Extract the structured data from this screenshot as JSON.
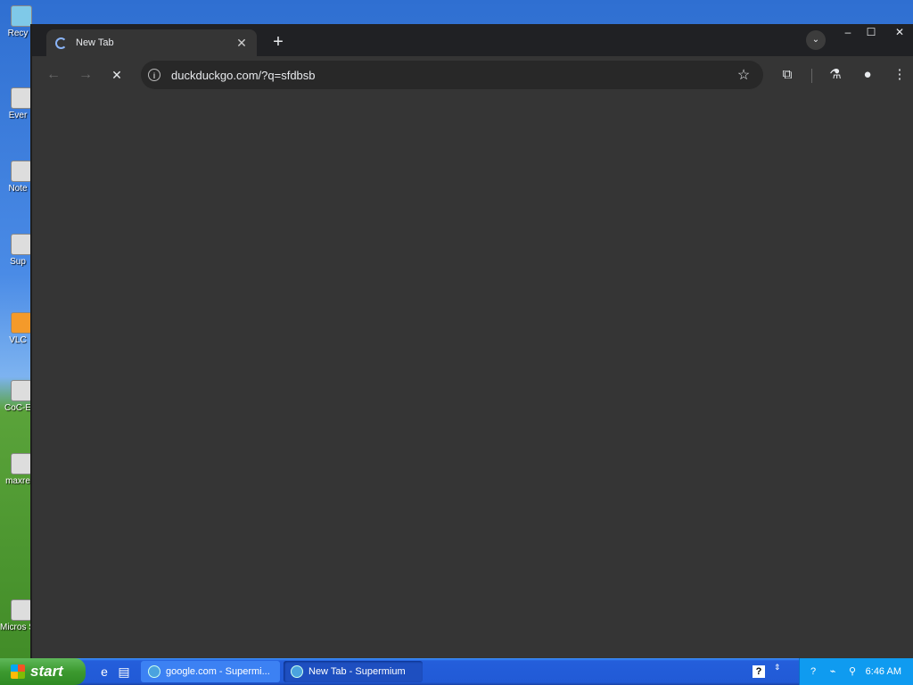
{
  "desktop": {
    "icons": [
      {
        "label": "Recy"
      },
      {
        "label": "Ever"
      },
      {
        "label": "Note"
      },
      {
        "label": "Sup"
      },
      {
        "label": "VLC"
      },
      {
        "label": "CoC-E"
      },
      {
        "label": "maxre"
      },
      {
        "label": "Micros Stud"
      }
    ]
  },
  "browser": {
    "tab": {
      "title": "New Tab",
      "close_label": "✕"
    },
    "new_tab_label": "+",
    "tab_search_label": "⌄",
    "window_controls": {
      "minimize": "–",
      "maximize": "☐",
      "close": "✕"
    },
    "nav": {
      "back": "←",
      "forward": "→",
      "stop": "✕"
    },
    "omnibox": {
      "info": "i",
      "url": "duckduckgo.com/?q=sfdbsb",
      "star": "☆"
    },
    "toolbar_icons": {
      "extensions": "⧉",
      "labs": "⚗",
      "profile": "●",
      "menu": "⋮"
    }
  },
  "taskbar": {
    "start_label": "start",
    "quicklaunch": [
      "e",
      "▤"
    ],
    "tasks": [
      {
        "label": "google.com - Supermi..."
      },
      {
        "label": "New Tab - Supermium"
      }
    ],
    "help_label": "?",
    "tray_arrow": "⇕",
    "tray_icons": [
      "?",
      "⌁",
      "⚲"
    ],
    "clock": "6:46 AM"
  }
}
